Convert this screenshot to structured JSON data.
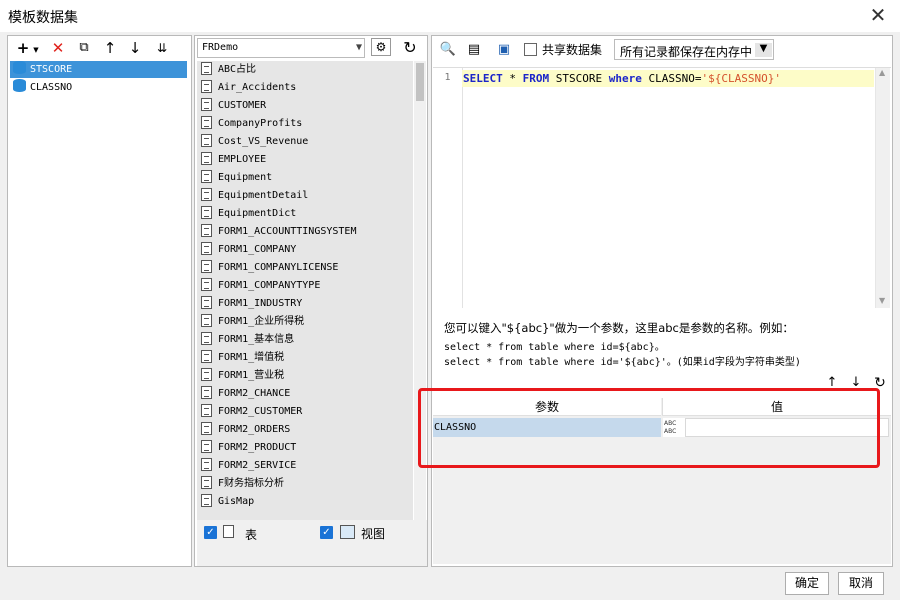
{
  "window": {
    "title": "模板数据集",
    "close_glyph": "✕"
  },
  "left": {
    "toolbar_icons": [
      "add-icon",
      "delete-icon",
      "copy-icon",
      "move-up-icon",
      "move-down-icon",
      "sort-icon"
    ],
    "items": [
      {
        "label": "STSCORE",
        "selected": true
      },
      {
        "label": "CLASSNO",
        "selected": false
      }
    ]
  },
  "middle": {
    "connection": "FRDemo",
    "tables": [
      "ABC占比",
      "Air_Accidents",
      "CUSTOMER",
      "CompanyProfits",
      "Cost_VS_Revenue",
      "EMPLOYEE",
      "Equipment",
      "EquipmentDetail",
      "EquipmentDict",
      "FORM1_ACCOUNTTINGSYSTEM",
      "FORM1_COMPANY",
      "FORM1_COMPANYLICENSE",
      "FORM1_COMPANYTYPE",
      "FORM1_INDUSTRY",
      "FORM1_企业所得税",
      "FORM1_基本信息",
      "FORM1_增值税",
      "FORM1_营业税",
      "FORM2_CHANCE",
      "FORM2_CUSTOMER",
      "FORM2_ORDERS",
      "FORM2_PRODUCT",
      "FORM2_SERVICE",
      "F财务指标分析",
      "GisMap"
    ],
    "filter_table_label": "表",
    "filter_view_label": "视图"
  },
  "right": {
    "share_label": "共享数据集",
    "cache_option": "所有记录都保存在内存中",
    "line_number": "1",
    "sql": {
      "kw1": "SELECT",
      "star": " * ",
      "kw2": "FROM",
      "table": " STSCORE ",
      "kw3": "where",
      "cond": " CLASSNO=",
      "param": "'${CLASSNO}'"
    },
    "hint_line1": "您可以键入\"${abc}\"做为一个参数，这里abc是参数的名称。例如：",
    "hint_line2": "select * from table where id=${abc}。",
    "hint_line3": "select * from table where id='${abc}'。(如果id字段为字符串类型)",
    "param_header": "参数",
    "value_header": "值",
    "param_rows": [
      {
        "name": "CLASSNO",
        "type_top": "ABC",
        "type_bottom": "ABC",
        "value": ""
      }
    ]
  },
  "buttons": {
    "ok": "确定",
    "cancel": "取消"
  },
  "colors": {
    "selection": "#3d93d9",
    "highlight_line": "#fdfcc8",
    "annotation": "#e8181b"
  }
}
